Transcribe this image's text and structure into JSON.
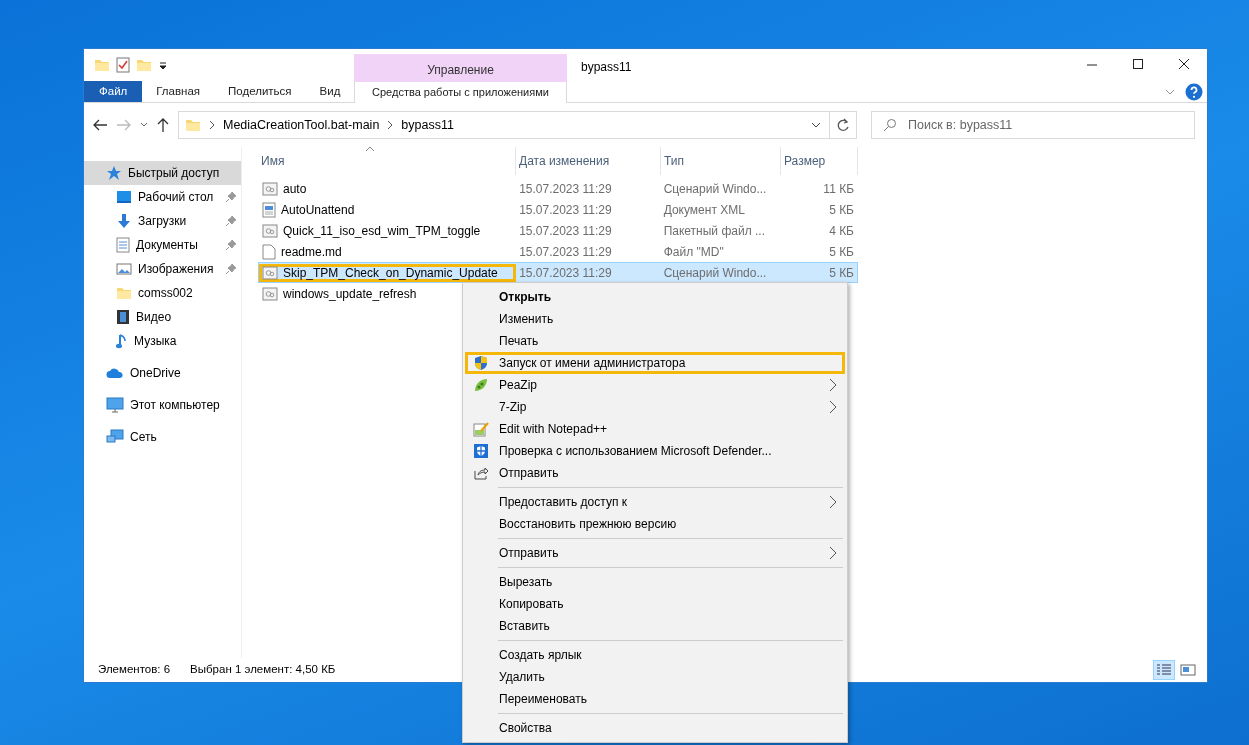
{
  "window": {
    "title": "bypass11"
  },
  "ribbon": {
    "context_group": "Управление",
    "tabs": [
      {
        "label": "Файл",
        "kind": "file",
        "selected": false
      },
      {
        "label": "Главная",
        "kind": "normal",
        "selected": false
      },
      {
        "label": "Поделиться",
        "kind": "normal",
        "selected": false
      },
      {
        "label": "Вид",
        "kind": "normal",
        "selected": false
      },
      {
        "label": "Средства работы с приложениями",
        "kind": "context",
        "selected": false
      }
    ]
  },
  "address": {
    "path": [
      "MediaCreationTool.bat-main",
      "bypass11"
    ]
  },
  "search": {
    "placeholder": "Поиск в: bypass11"
  },
  "sidebar": {
    "items": [
      {
        "label": "Быстрый доступ",
        "kind": "quick",
        "selected": true,
        "children": [
          {
            "label": "Рабочий стол",
            "kind": "desktop",
            "pinned": true,
            "selected": false
          },
          {
            "label": "Загрузки",
            "kind": "downloads",
            "pinned": true,
            "selected": false
          },
          {
            "label": "Документы",
            "kind": "documents",
            "pinned": true,
            "selected": false
          },
          {
            "label": "Изображения",
            "kind": "pictures",
            "pinned": true,
            "selected": false
          },
          {
            "label": "comss002",
            "kind": "folder",
            "pinned": false,
            "selected": false
          },
          {
            "label": "Видео",
            "kind": "video",
            "pinned": false,
            "selected": false
          },
          {
            "label": "Музыка",
            "kind": "music",
            "pinned": false,
            "selected": false
          }
        ]
      },
      {
        "label": "OneDrive",
        "kind": "cloud",
        "selected": false
      },
      {
        "label": "Этот компьютер",
        "kind": "computer",
        "selected": false
      },
      {
        "label": "Сеть",
        "kind": "network",
        "selected": false
      }
    ]
  },
  "file_list": {
    "columns": [
      "Имя",
      "Дата изменения",
      "Тип",
      "Размер"
    ],
    "rows": [
      {
        "name": "auto",
        "kind": "script",
        "date": "15.07.2023 11:29",
        "type": "Сценарий Windo...",
        "size": "11 КБ",
        "selected": false,
        "annotated": false
      },
      {
        "name": "AutoUnattend",
        "kind": "xml",
        "date": "15.07.2023 11:29",
        "type": "Документ XML",
        "size": "5 КБ",
        "selected": false,
        "annotated": false
      },
      {
        "name": "Quick_11_iso_esd_wim_TPM_toggle",
        "kind": "script",
        "date": "15.07.2023 11:29",
        "type": "Пакетный файл ...",
        "size": "4 КБ",
        "selected": false,
        "annotated": false
      },
      {
        "name": "readme.md",
        "kind": "blank",
        "date": "15.07.2023 11:29",
        "type": "Файл \"MD\"",
        "size": "5 КБ",
        "selected": false,
        "annotated": false
      },
      {
        "name": "Skip_TPM_Check_on_Dynamic_Update",
        "kind": "script",
        "date": "15.07.2023 11:29",
        "type": "Сценарий Windo...",
        "size": "5 КБ",
        "selected": true,
        "annotated": true
      },
      {
        "name": "windows_update_refresh",
        "kind": "script",
        "selected": false,
        "annotated": false
      }
    ]
  },
  "context_menu": {
    "groups": [
      [
        {
          "label": "Открыть",
          "bold": true,
          "submenu": false,
          "annotated": false
        },
        {
          "label": "Изменить",
          "bold": false,
          "submenu": false,
          "annotated": false
        },
        {
          "label": "Печать",
          "bold": false,
          "submenu": false,
          "annotated": false
        },
        {
          "label": "Запуск от имени администратора",
          "kind": "shield",
          "bold": false,
          "submenu": false,
          "annotated": true
        },
        {
          "label": "PeaZip",
          "kind": "peazip",
          "bold": false,
          "submenu": true,
          "annotated": false
        },
        {
          "label": "7-Zip",
          "bold": false,
          "submenu": true,
          "annotated": false
        },
        {
          "label": "Edit with Notepad++",
          "kind": "notepad",
          "bold": false,
          "submenu": false,
          "annotated": false
        },
        {
          "label": "Проверка с использованием Microsoft Defender...",
          "kind": "defender",
          "bold": false,
          "submenu": false,
          "annotated": false
        },
        {
          "label": "Отправить",
          "kind": "share",
          "bold": false,
          "submenu": false,
          "annotated": false
        }
      ],
      [
        {
          "label": "Предоставить доступ к",
          "bold": false,
          "submenu": true,
          "annotated": false
        },
        {
          "label": "Восстановить прежнюю версию",
          "bold": false,
          "submenu": false,
          "annotated": false
        }
      ],
      [
        {
          "label": "Отправить",
          "bold": false,
          "submenu": true,
          "annotated": false
        }
      ],
      [
        {
          "label": "Вырезать",
          "bold": false,
          "submenu": false,
          "annotated": false
        },
        {
          "label": "Копировать",
          "bold": false,
          "submenu": false,
          "annotated": false
        },
        {
          "label": "Вставить",
          "bold": false,
          "submenu": false,
          "annotated": false
        }
      ],
      [
        {
          "label": "Создать ярлык",
          "bold": false,
          "submenu": false,
          "annotated": false
        },
        {
          "label": "Удалить",
          "bold": false,
          "submenu": false,
          "annotated": false
        },
        {
          "label": "Переименовать",
          "bold": false,
          "submenu": false,
          "annotated": false
        }
      ],
      [
        {
          "label": "Свойства",
          "bold": false,
          "submenu": false,
          "annotated": false
        }
      ]
    ]
  },
  "status_bar": {
    "count": "Элементов: 6",
    "selection": "Выбран 1 элемент: 4,50 КБ",
    "views": [
      {
        "kind": "details",
        "selected": true
      },
      {
        "kind": "tiles",
        "selected": false
      }
    ]
  }
}
